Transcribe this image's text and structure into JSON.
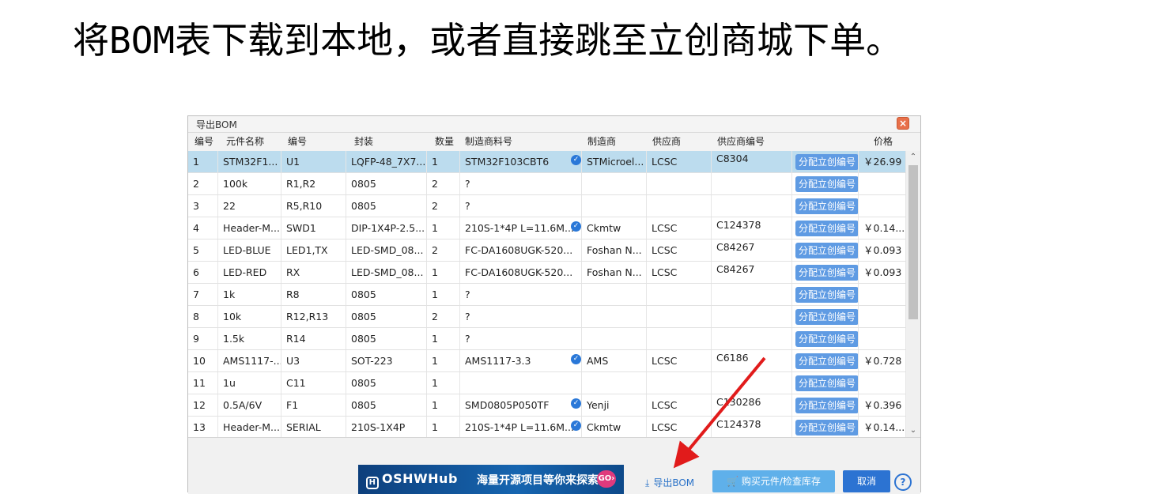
{
  "heading": "将BOM表下载到本地，或者直接跳至立创商城下单。",
  "dialog": {
    "title": "导出BOM",
    "close_label": "×",
    "columns": [
      "编号",
      "元件名称",
      "编号",
      "封装",
      "数量",
      "制造商料号",
      "制造商",
      "供应商",
      "供应商编号",
      "价格"
    ],
    "assign_label": "分配立创编号",
    "verified_icon": "shield-check-icon",
    "rows": [
      {
        "no": "1",
        "name": "STM32F1...",
        "des": "U1",
        "pkg": "LQFP-48_7X7...",
        "qty": "1",
        "mpn": "STM32F103CBT6",
        "verified": true,
        "mfr": "STMicroel...",
        "sup": "LCSC",
        "supno": "C8304",
        "price": "￥26.99",
        "selected": true
      },
      {
        "no": "2",
        "name": "100k",
        "des": "R1,R2",
        "pkg": "0805",
        "qty": "2",
        "mpn": "?",
        "verified": false,
        "mfr": "",
        "sup": "",
        "supno": "",
        "price": ""
      },
      {
        "no": "3",
        "name": "22",
        "des": "R5,R10",
        "pkg": "0805",
        "qty": "2",
        "mpn": "?",
        "verified": false,
        "mfr": "",
        "sup": "",
        "supno": "",
        "price": ""
      },
      {
        "no": "4",
        "name": "Header-M...",
        "des": "SWD1",
        "pkg": "DIP-1X4P-2.5...",
        "qty": "1",
        "mpn": "210S-1*4P L=11.6M...",
        "verified": true,
        "mfr": "Ckmtw",
        "sup": "LCSC",
        "supno": "C124378",
        "price": "￥0.14..."
      },
      {
        "no": "5",
        "name": "LED-BLUE",
        "des": "LED1,TX",
        "pkg": "LED-SMD_08...",
        "qty": "2",
        "mpn": "FC-DA1608UGK-520...",
        "verified": false,
        "mfr": "Foshan N...",
        "sup": "LCSC",
        "supno": "C84267",
        "price": "￥0.093"
      },
      {
        "no": "6",
        "name": "LED-RED",
        "des": "RX",
        "pkg": "LED-SMD_08...",
        "qty": "1",
        "mpn": "FC-DA1608UGK-520...",
        "verified": false,
        "mfr": "Foshan N...",
        "sup": "LCSC",
        "supno": "C84267",
        "price": "￥0.093"
      },
      {
        "no": "7",
        "name": "1k",
        "des": "R8",
        "pkg": "0805",
        "qty": "1",
        "mpn": "?",
        "verified": false,
        "mfr": "",
        "sup": "",
        "supno": "",
        "price": ""
      },
      {
        "no": "8",
        "name": "10k",
        "des": "R12,R13",
        "pkg": "0805",
        "qty": "2",
        "mpn": "?",
        "verified": false,
        "mfr": "",
        "sup": "",
        "supno": "",
        "price": ""
      },
      {
        "no": "9",
        "name": "1.5k",
        "des": "R14",
        "pkg": "0805",
        "qty": "1",
        "mpn": "?",
        "verified": false,
        "mfr": "",
        "sup": "",
        "supno": "",
        "price": ""
      },
      {
        "no": "10",
        "name": "AMS1117-...",
        "des": "U3",
        "pkg": "SOT-223",
        "qty": "1",
        "mpn": "AMS1117-3.3",
        "verified": true,
        "mfr": "AMS",
        "sup": "LCSC",
        "supno": "C6186",
        "price": "￥0.728"
      },
      {
        "no": "11",
        "name": "1u",
        "des": "C11",
        "pkg": "0805",
        "qty": "1",
        "mpn": "",
        "verified": false,
        "mfr": "",
        "sup": "",
        "supno": "",
        "price": ""
      },
      {
        "no": "12",
        "name": "0.5A/6V",
        "des": "F1",
        "pkg": "0805",
        "qty": "1",
        "mpn": "SMD0805P050TF",
        "verified": true,
        "mfr": "Yenji",
        "sup": "LCSC",
        "supno": "C130286",
        "price": "￥0.396"
      },
      {
        "no": "13",
        "name": "Header-M...",
        "des": "SERIAL",
        "pkg": "210S-1X4P",
        "qty": "1",
        "mpn": "210S-1*4P L=11.6M...",
        "verified": true,
        "mfr": "Ckmtw",
        "sup": "LCSC",
        "supno": "C124378",
        "price": "￥0.14..."
      }
    ]
  },
  "footer": {
    "banner_logo": "OSHWHub",
    "banner_slogan": "海量开源项目等你来探索",
    "banner_go": "GO›",
    "export_label": "导出BOM",
    "buy_label": "购买元件/检查库存",
    "cancel_label": "取消",
    "help_label": "?"
  },
  "colors": {
    "selected_row": "#bcdcee",
    "assign_button": "#5f9be3",
    "annotation_arrow": "#e11b1b"
  }
}
